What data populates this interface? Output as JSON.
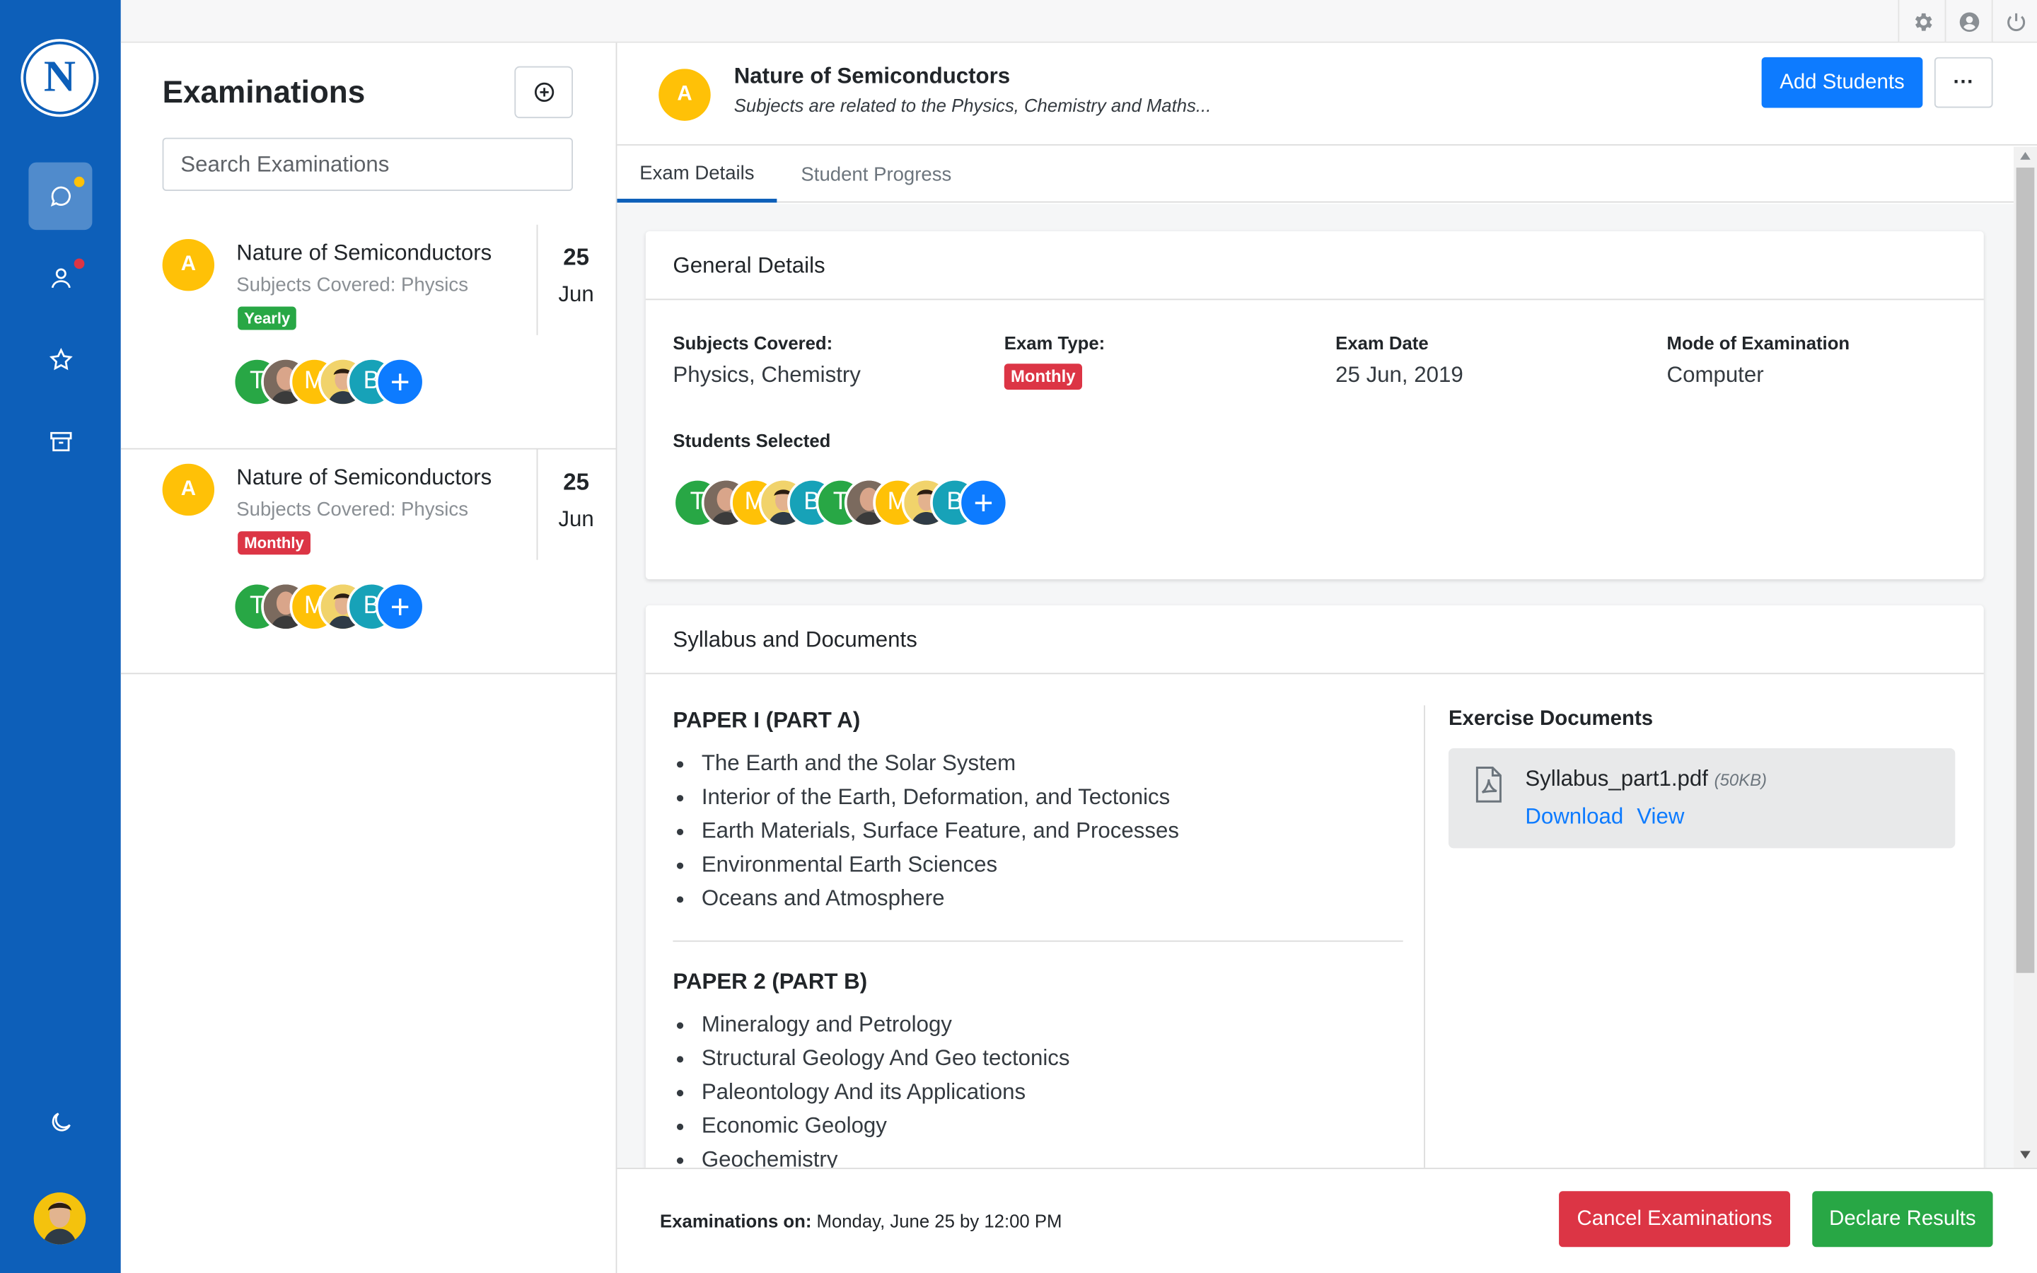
{
  "app": {
    "logo_letter": "N"
  },
  "nav": {
    "items": [
      {
        "icon": "chat-icon",
        "active": true
      },
      {
        "icon": "user-icon"
      },
      {
        "icon": "star-icon"
      },
      {
        "icon": "archive-icon"
      }
    ],
    "bottom": [
      {
        "icon": "moon-icon"
      },
      {
        "icon": "avatar"
      }
    ]
  },
  "topbar": {
    "icons": [
      "gear-icon",
      "user-circle-icon",
      "power-icon"
    ]
  },
  "list": {
    "title": "Examinations",
    "search_placeholder": "Search Examinations",
    "items": [
      {
        "avatar": "A",
        "title": "Nature of Semiconductors",
        "subtitle": "Subjects Covered: Physics",
        "badge": "Yearly",
        "badge_color": "#28a745",
        "day": "25",
        "month": "Jun",
        "students": [
          "T",
          "",
          "M",
          "",
          "B",
          "+"
        ]
      },
      {
        "avatar": "A",
        "title": "Nature of Semiconductors",
        "subtitle": "Subjects Covered: Physics",
        "badge": "Monthly",
        "badge_color": "#dc3545",
        "day": "25",
        "month": "Jun",
        "students": [
          "T",
          "",
          "M",
          "",
          "B",
          "+"
        ]
      }
    ]
  },
  "header": {
    "avatar": "A",
    "title": "Nature of Semiconductors",
    "subtitle": "Subjects are related to the Physics, Chemistry and Maths...",
    "add_students": "Add Students",
    "more": "···"
  },
  "tabs": [
    {
      "label": "Exam Details",
      "active": true
    },
    {
      "label": "Student Progress",
      "active": false
    }
  ],
  "general": {
    "heading": "General Details",
    "subjects_label": "Subjects Covered:",
    "subjects_value": "Physics, Chemistry",
    "type_label": "Exam Type:",
    "type_value": "Monthly",
    "date_label": "Exam Date",
    "date_value": "25 Jun, 2019",
    "mode_label": "Mode of Examination",
    "mode_value": "Computer",
    "students_label": "Students Selected",
    "students": [
      "T",
      "",
      "M",
      "",
      "B",
      "T",
      "",
      "M",
      "",
      "B",
      "+"
    ]
  },
  "syllabus": {
    "heading": "Syllabus and Documents",
    "papers": [
      {
        "title": "PAPER I (PART A)",
        "topics": [
          "The Earth and the Solar System",
          "Interior of the Earth, Deformation, and Tectonics",
          "Earth Materials, Surface Feature, and Processes",
          "Environmental Earth Sciences",
          "Oceans and Atmosphere"
        ]
      },
      {
        "title": "PAPER 2 (PART B)",
        "topics": [
          "Mineralogy and Petrology",
          "Structural Geology And Geo tectonics",
          "Paleontology And its Applications",
          "Economic Geology",
          "Geochemistry"
        ]
      }
    ],
    "docs_heading": "Exercise Documents",
    "doc": {
      "name": "Syllabus_part1.pdf",
      "size": "(50KB)",
      "download": "Download",
      "view": "View"
    }
  },
  "footer": {
    "label": "Examinations on:",
    "value": "Monday, June 25 by 12:00 PM",
    "cancel": "Cancel Examinations",
    "declare": "Declare Results"
  },
  "colors": {
    "brand": "#0d5fb9",
    "primary": "#0d7bff",
    "danger": "#dc3545",
    "success": "#28a745",
    "avatar": "#ffc107"
  }
}
